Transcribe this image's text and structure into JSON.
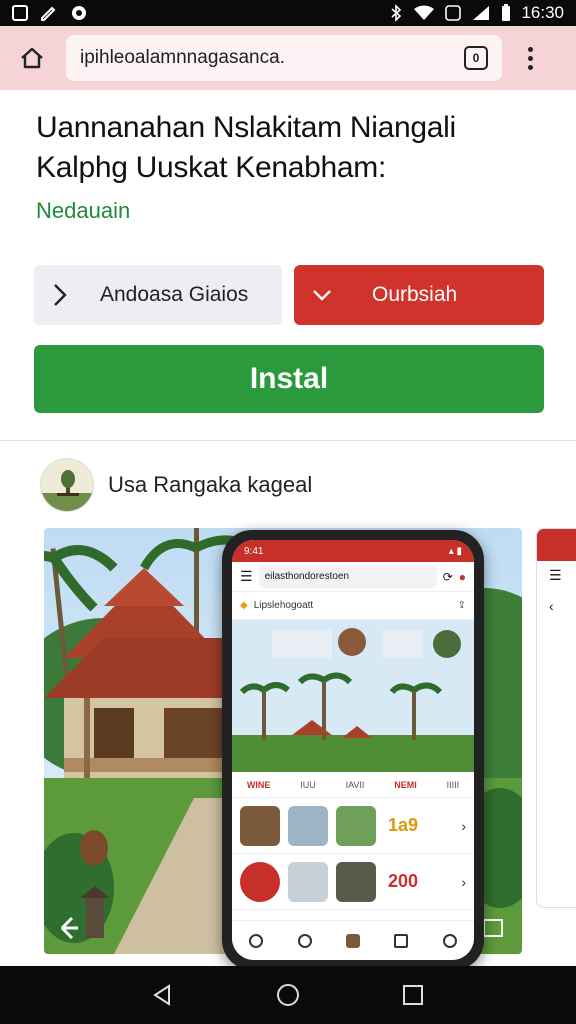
{
  "status_bar": {
    "time": "16:30"
  },
  "browser": {
    "url": "ipihleoalamnnagasanca.",
    "tab_count": "0"
  },
  "app": {
    "title": "Uannanahan Nslakitam Niangali Kalphg Uuskat Kenabham:",
    "developer": "Nedauain"
  },
  "buttons": {
    "android": "Andoasa Giaios",
    "download": "Ourbsiah",
    "install": "Instal"
  },
  "publisher": {
    "name": "Usa Rangaka kageal"
  },
  "phone": {
    "status_time": "9:41",
    "url": "eilasthondorestoen",
    "bar_text": "Lipslehogoatt",
    "tabs": [
      "WINE",
      "IUU",
      "IAVII",
      "NEMI",
      "IIIII"
    ],
    "row1_value": "1a9",
    "row2_value": "200"
  },
  "colors": {
    "accent_red": "#d0332b",
    "install_green": "#2a9a3c",
    "developer_green": "#1e8a3a",
    "browser_pink": "#f5d3d6"
  }
}
